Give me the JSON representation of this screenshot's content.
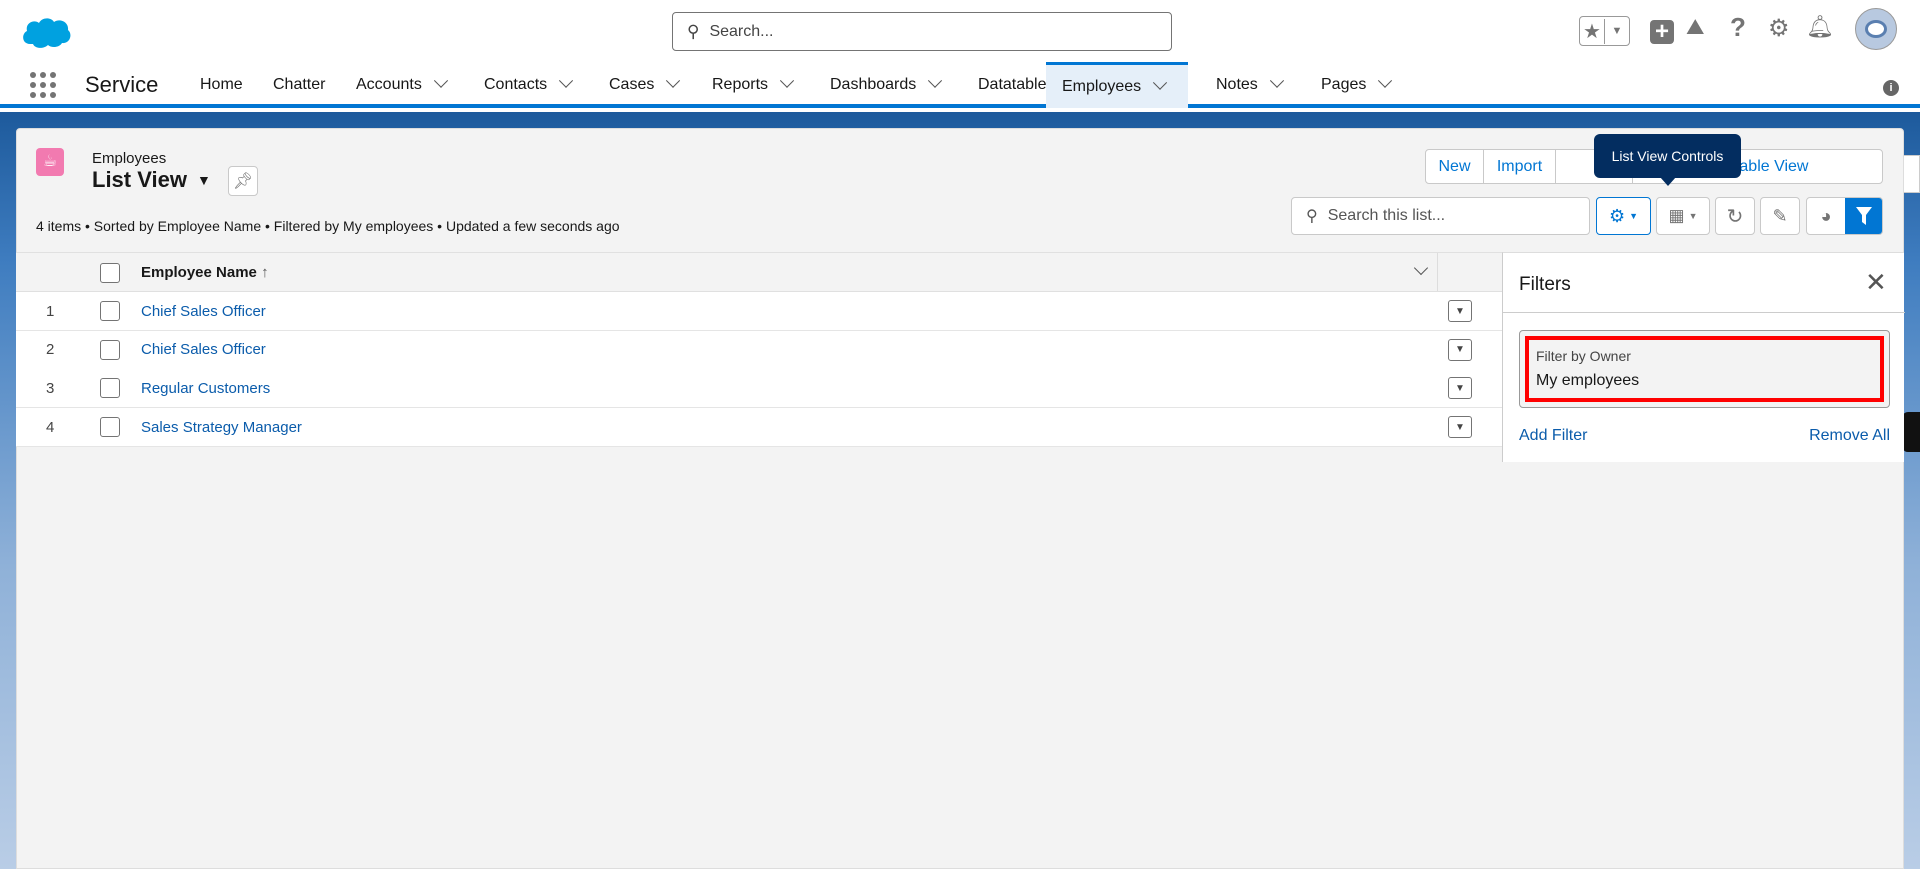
{
  "header": {
    "search_placeholder": "Search...",
    "app_name": "Service"
  },
  "nav": {
    "items": [
      {
        "label": "Home",
        "dropdown": false
      },
      {
        "label": "Chatter",
        "dropdown": false
      },
      {
        "label": "Accounts",
        "dropdown": true
      },
      {
        "label": "Contacts",
        "dropdown": true
      },
      {
        "label": "Cases",
        "dropdown": true
      },
      {
        "label": "Reports",
        "dropdown": true
      },
      {
        "label": "Dashboards",
        "dropdown": true
      },
      {
        "label": "Datatable",
        "dropdown": false
      },
      {
        "label": "Employees",
        "dropdown": true,
        "active": true
      },
      {
        "label": "Notes",
        "dropdown": true
      },
      {
        "label": "Pages",
        "dropdown": true
      }
    ]
  },
  "list": {
    "object": "Employees",
    "view": "List View",
    "status": "4 items • Sorted by Employee Name • Filtered by My employees • Updated a few seconds ago",
    "buttons": {
      "new": "New",
      "import": "Import",
      "printable": "Printable View"
    },
    "tooltip": "List View Controls",
    "search_placeholder": "Search this list...",
    "column": "Employee Name",
    "sort_icon": "↑",
    "rows": [
      {
        "num": "1",
        "name": "Chief Sales Officer"
      },
      {
        "num": "2",
        "name": "Chief Sales Officer"
      },
      {
        "num": "3",
        "name": "Regular Customers"
      },
      {
        "num": "4",
        "name": "Sales Strategy Manager"
      }
    ]
  },
  "filters": {
    "title": "Filters",
    "filter_label": "Filter by Owner",
    "filter_value": "My employees",
    "add": "Add Filter",
    "remove_all": "Remove All"
  },
  "colors": {
    "brand": "#0176d3",
    "link": "#0b5cab",
    "highlight": "#ff0000",
    "tooltip": "#032d60",
    "object_icon": "#f27ab0"
  }
}
